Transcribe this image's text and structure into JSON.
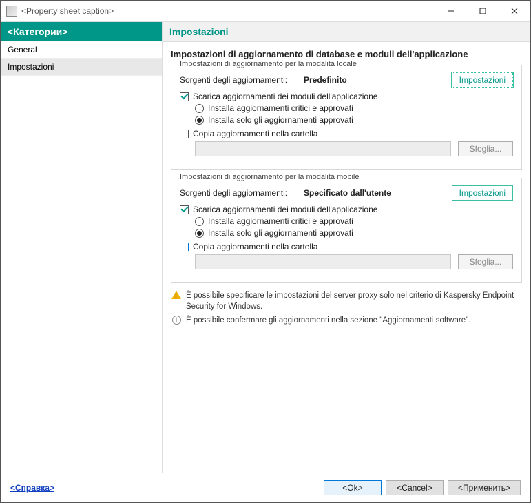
{
  "window": {
    "title": "<Property sheet caption>"
  },
  "sidebar": {
    "header": "<Категории>",
    "items": [
      {
        "label": "General"
      },
      {
        "label": "Impostazioni"
      }
    ]
  },
  "content": {
    "header": "Impostazioni",
    "section_title": "Impostazioni di aggiornamento di database e moduli dell'applicazione",
    "groups": {
      "local": {
        "legend": "Impostazioni di aggiornamento per la modalità locale",
        "sources_label": "Sorgenti degli aggiornamenti:",
        "sources_value": "Predefinito",
        "settings_btn": "Impostazioni",
        "download_check": "Scarica aggiornamenti dei moduli dell'applicazione",
        "radio_critical": "Installa aggiornamenti critici e approvati",
        "radio_approved": "Installa solo gli aggiornamenti approvati",
        "copy_check": "Copia aggiornamenti nella cartella",
        "browse_btn": "Sfoglia..."
      },
      "mobile": {
        "legend": "Impostazioni di aggiornamento per la modalità mobile",
        "sources_label": "Sorgenti degli aggiornamenti:",
        "sources_value": "Specificato dall'utente",
        "settings_btn": "Impostazioni",
        "download_check": "Scarica aggiornamenti dei moduli dell'applicazione",
        "radio_critical": "Installa aggiornamenti critici e approvati",
        "radio_approved": "Installa solo gli aggiornamenti approvati",
        "copy_check": "Copia aggiornamenti nella cartella",
        "browse_btn": "Sfoglia..."
      }
    },
    "notes": {
      "warn": "È possibile specificare le impostazioni del server proxy solo nel criterio di Kaspersky Endpoint Security for Windows.",
      "info": "È possibile confermare gli aggiornamenti nella sezione \"Aggiornamenti software\"."
    }
  },
  "footer": {
    "help": "<Справка>",
    "ok": "<Ok>",
    "cancel": "<Cancel>",
    "apply": "<Применить>"
  }
}
